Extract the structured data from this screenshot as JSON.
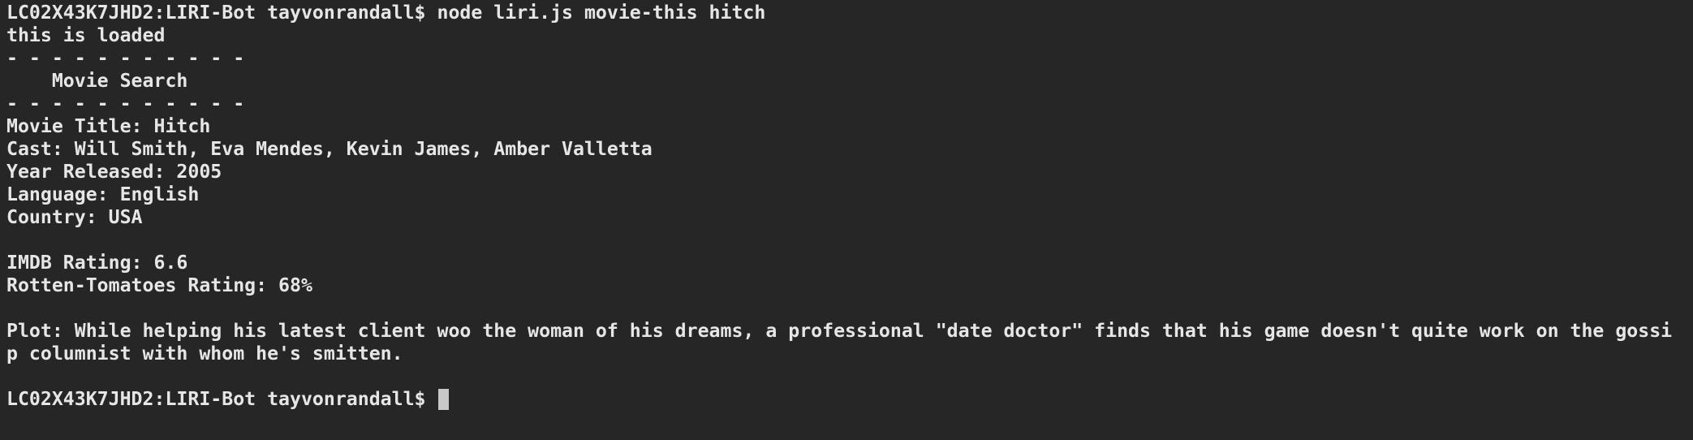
{
  "terminal": {
    "command_line": "LC02X43K7JHD2:LIRI-Bot tayvonrandall$ node liri.js movie-this hitch",
    "loaded_msg": "this is loaded",
    "divider_top": "- - - - - - - - - - -",
    "section_title": "    Movie Search",
    "divider_bottom": "- - - - - - - - - - -",
    "movie_title": "Movie Title: Hitch",
    "cast": "Cast: Will Smith, Eva Mendes, Kevin James, Amber Valletta",
    "year": "Year Released: 2005",
    "language": "Language: English",
    "country": "Country: USA",
    "imdb": "IMDB Rating: 6.6",
    "rotten": "Rotten-Tomatoes Rating: 68%",
    "plot_line1": "Plot: While helping his latest client woo the woman of his dreams, a professional \"date doctor\" finds that his game doesn't quite work on the gossi",
    "plot_line2": "p columnist with whom he's smitten.",
    "prompt": "LC02X43K7JHD2:LIRI-Bot tayvonrandall$ "
  }
}
